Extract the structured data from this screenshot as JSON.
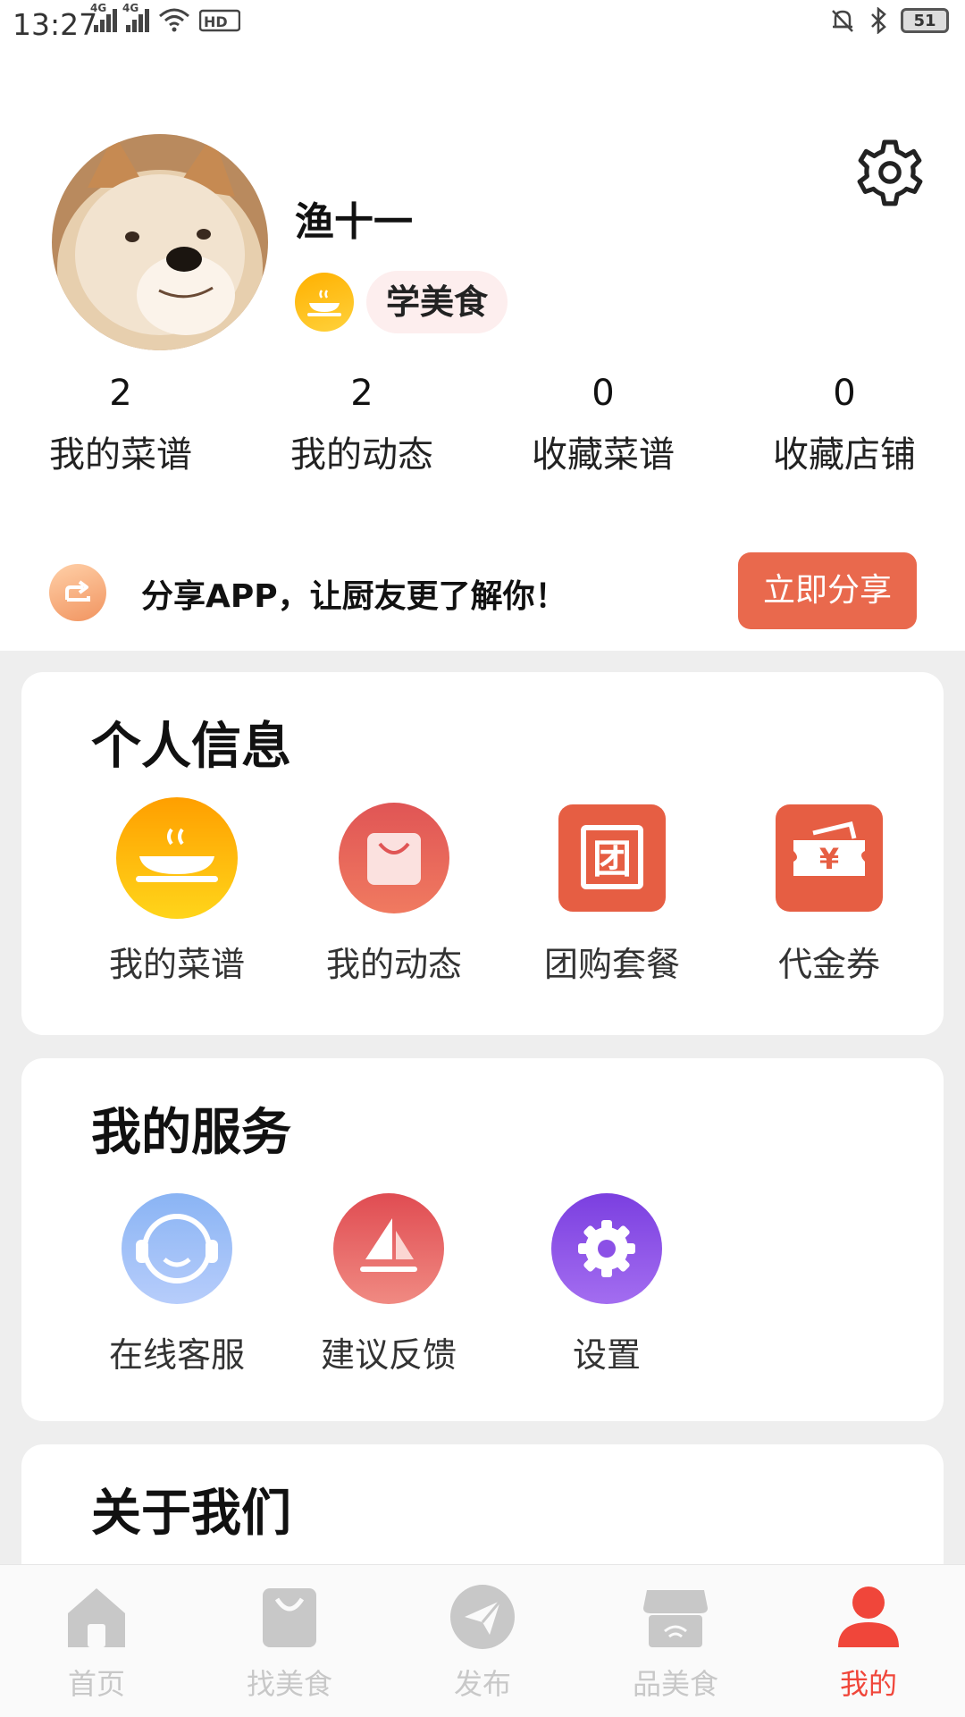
{
  "status_bar": {
    "time": "13:27",
    "signal_1": "4G",
    "signal_2": "4G",
    "battery": "51"
  },
  "profile": {
    "username": "渔十一",
    "badge": "学美食",
    "settings_icon": "gear-icon"
  },
  "stats": [
    {
      "value": "2",
      "label": "我的菜谱"
    },
    {
      "value": "2",
      "label": "我的动态"
    },
    {
      "value": "0",
      "label": "收藏菜谱"
    },
    {
      "value": "0",
      "label": "收藏店铺"
    }
  ],
  "share": {
    "text": "分享APP，让厨友更了解你！",
    "button": "立即分享"
  },
  "personal_info": {
    "title": "个人信息",
    "items": [
      {
        "label": "我的菜谱",
        "icon": "bowl-icon"
      },
      {
        "label": "我的动态",
        "icon": "bag-icon"
      },
      {
        "label": "团购套餐",
        "icon": "group-buy-icon"
      },
      {
        "label": "代金券",
        "icon": "voucher-icon"
      }
    ]
  },
  "services": {
    "title": "我的服务",
    "items": [
      {
        "label": "在线客服",
        "icon": "headset-icon"
      },
      {
        "label": "建议反馈",
        "icon": "feedback-icon"
      },
      {
        "label": "设置",
        "icon": "gear-icon"
      }
    ]
  },
  "about": {
    "title": "关于我们"
  },
  "tabbar": {
    "items": [
      {
        "label": "首页",
        "icon": "home-icon"
      },
      {
        "label": "找美食",
        "icon": "shopping-bag-icon"
      },
      {
        "label": "发布",
        "icon": "paper-plane-icon"
      },
      {
        "label": "品美食",
        "icon": "store-icon"
      },
      {
        "label": "我的",
        "icon": "user-icon"
      }
    ],
    "active": "我的",
    "active_color": "#f0463a",
    "inactive_color": "#c8c8c8"
  },
  "colors": {
    "accent": "#e9694d",
    "badge_gold": "#ffc21a",
    "page_bg": "#eeeeee"
  }
}
